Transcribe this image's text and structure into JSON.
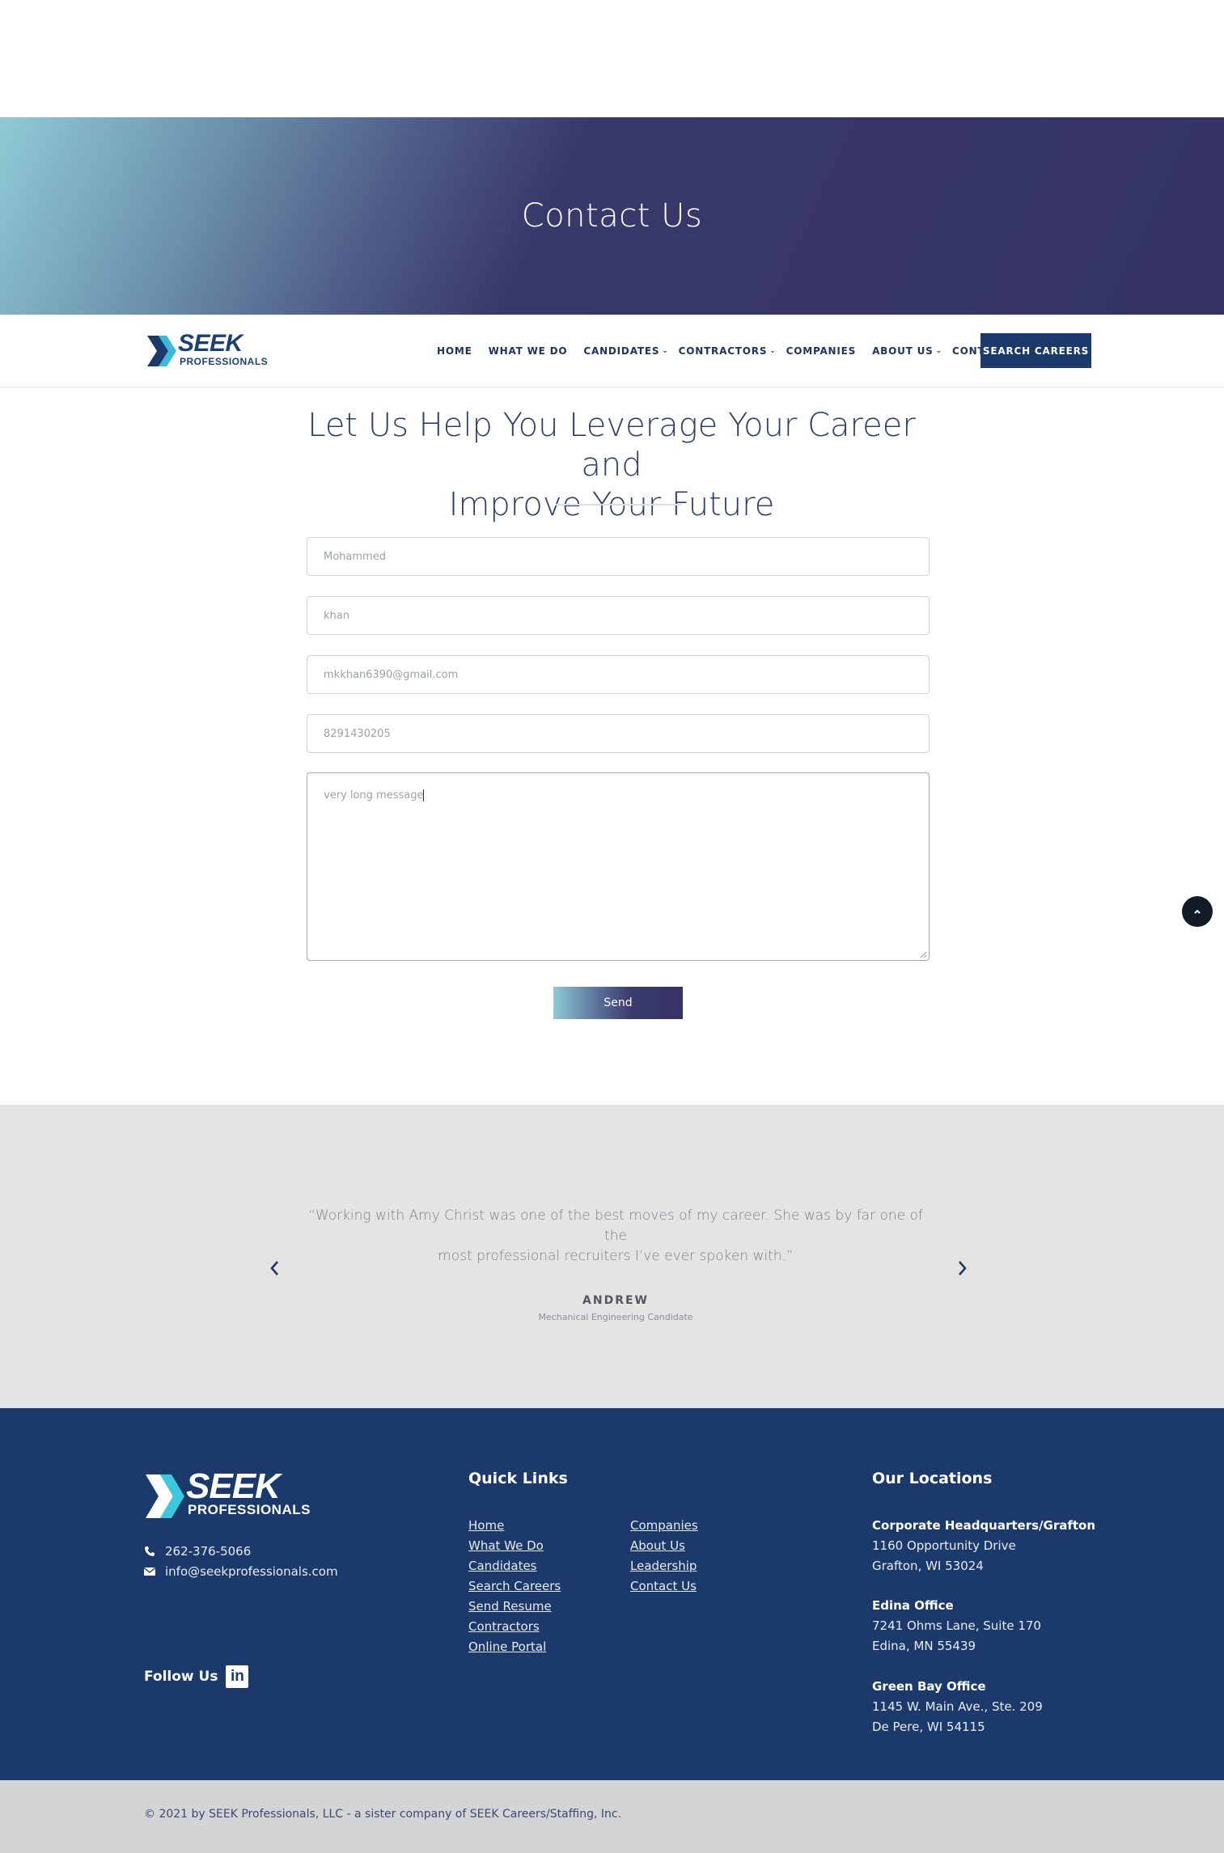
{
  "hero": {
    "title": "Contact Us"
  },
  "nav": {
    "logo_brand": "SEEK",
    "logo_sub": "PROFESSIONALS",
    "items": [
      {
        "label": "HOME",
        "dropdown": false
      },
      {
        "label": "WHAT WE DO",
        "dropdown": false
      },
      {
        "label": "CANDIDATES",
        "dropdown": true
      },
      {
        "label": "CONTRACTORS",
        "dropdown": true
      },
      {
        "label": "COMPANIES",
        "dropdown": false
      },
      {
        "label": "ABOUT US",
        "dropdown": true
      },
      {
        "label": "CONTACT US",
        "dropdown": false
      }
    ],
    "search_button": "SEARCH CAREERS"
  },
  "form": {
    "headline_line1": "Let Us Help You Leverage Your Career and",
    "headline_line2": "Improve Your Future",
    "first_name": "Mohammed",
    "last_name": "khan",
    "email": "mkkhan6390@gmail.com",
    "phone": "8291430205",
    "message": "very long message",
    "send_label": "Send"
  },
  "testimonial": {
    "quote_line1": "“Working with Amy Christ was one of the best moves of my career. She was by far one of the",
    "quote_line2": "most professional recruiters I’ve ever spoken with.”",
    "author": "ANDREW",
    "role": "Mechanical Engineering Candidate"
  },
  "footer": {
    "logo_brand": "SEEK",
    "logo_sub": "PROFESSIONALS",
    "phone": "262-376-5066",
    "email": "info@seekprofessionals.com",
    "follow_label": "Follow Us",
    "linkedin_glyph": "in",
    "quick_links_title": "Quick Links",
    "quick_links_col1": [
      "Home",
      "What We Do",
      "Candidates",
      "Search Careers",
      "Send Resume",
      "Contractors",
      "Online Portal"
    ],
    "quick_links_col2": [
      "Companies",
      "About Us",
      "Leadership",
      "Contact Us"
    ],
    "locations_title": "Our Locations",
    "locations": [
      {
        "name": "Corporate Headquarters/Grafton",
        "line1": "1160 Opportunity Drive",
        "line2": "Grafton, WI 53024"
      },
      {
        "name": "Edina Office",
        "line1": "7241 Ohms Lane, Suite 170",
        "line2": "Edina, MN 55439"
      },
      {
        "name": "Green Bay Office",
        "line1": "1145 W. Main Ave., Ste. 209",
        "line2": "De Pere, WI 54115"
      }
    ],
    "copyright": "© 2021 by SEEK Professionals, LLC - a sister company of SEEK Careers/Staffing, Inc."
  },
  "colors": {
    "navy": "#1b3a6b",
    "hero_purple": "#363466",
    "hero_teal": "#8fcad6",
    "testimonial_bg": "#e4e4e5",
    "copyright_bg": "#d3d4d6"
  }
}
